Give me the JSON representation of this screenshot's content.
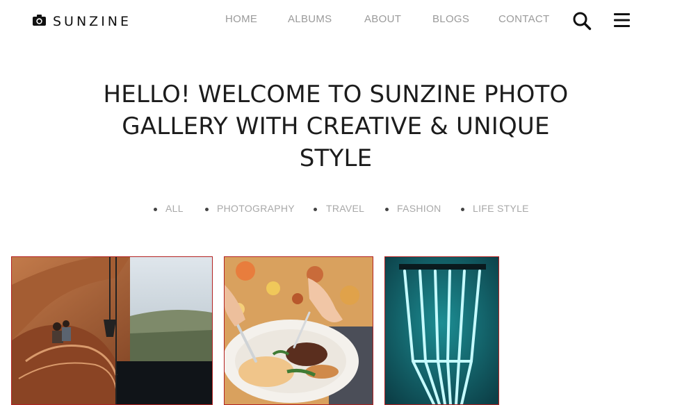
{
  "brand": {
    "name": "SUNZINE",
    "icon": "camera-icon"
  },
  "nav": {
    "items": [
      {
        "label": "HOME"
      },
      {
        "label": "ALBUMS"
      },
      {
        "label": "ABOUT"
      },
      {
        "label": "BLOGS"
      },
      {
        "label": "CONTACT"
      }
    ],
    "search_icon": "search-icon",
    "menu_icon": "hamburger-menu-icon"
  },
  "hero": {
    "title": "HELLO! WELCOME TO SUNZINE PHOTO GALLERY WITH CREATIVE & UNIQUE STYLE"
  },
  "filters": [
    {
      "label": "ALL"
    },
    {
      "label": "PHOTOGRAPHY"
    },
    {
      "label": "TRAVEL"
    },
    {
      "label": "FASHION"
    },
    {
      "label": "LIFE STYLE"
    }
  ],
  "colors": {
    "nav_text": "#9a9a9a",
    "filter_text": "#a8a8a8",
    "card_border": "#b32121",
    "heading": "#1c1c1c"
  }
}
